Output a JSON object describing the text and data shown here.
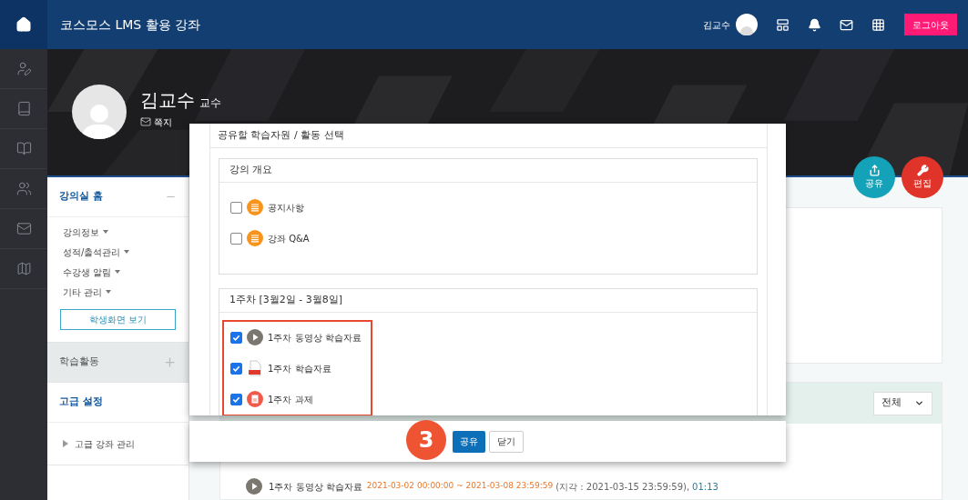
{
  "topbar": {
    "title": "코스모스 LMS 활용 강좌",
    "user_name": "김교수",
    "logout": "로그아웃"
  },
  "profile": {
    "name": "김교수",
    "role": "교수",
    "message_link": "쪽지"
  },
  "sidebar": {
    "sections": [
      {
        "title": "강의실 홈",
        "kind": "link",
        "expanded": true,
        "items": [
          {
            "label": "강의정보",
            "kind": "dropdown"
          },
          {
            "label": "성적/출석관리",
            "kind": "dropdown"
          },
          {
            "label": "수강생 알림",
            "kind": "dropdown"
          },
          {
            "label": "기타 관리",
            "kind": "dropdown"
          }
        ],
        "button": "학생화면 보기"
      },
      {
        "title": "학습활동",
        "kind": "collapsible",
        "expanded": false
      },
      {
        "title": "고급 설정",
        "kind": "link",
        "items": [
          {
            "label": "고급 강좌 관리",
            "kind": "tree"
          }
        ]
      }
    ]
  },
  "action_buttons": [
    {
      "label": "공유",
      "kind": "share"
    },
    {
      "label": "편집",
      "kind": "edit"
    }
  ],
  "filter_select": {
    "value": "전체"
  },
  "activity_line": {
    "title": "1주차 동영상 학습자료",
    "period": "2021-03-02 00:00:00 ~ 2021-03-08 23:59:59",
    "late": "(지각 : 2021-03-15 23:59:59),",
    "duration": "01:13"
  },
  "modal": {
    "title": "공유할 학습자원 / 활동 선택",
    "sections": [
      {
        "title": "강의 개요",
        "highlighted": false,
        "items": [
          {
            "label": "공지사항",
            "kind": "notice",
            "checked": false
          },
          {
            "label": "강좌 Q&A",
            "kind": "notice",
            "checked": false
          }
        ]
      },
      {
        "title": "1주차 [3월2일 - 3월8일]",
        "highlighted": true,
        "items": [
          {
            "label": "1주차 동영상 학습자료",
            "kind": "video",
            "checked": true
          },
          {
            "label": "1주차 학습자료",
            "kind": "pdf",
            "checked": true
          },
          {
            "label": "1주차 과제",
            "kind": "assignment",
            "checked": true
          }
        ]
      }
    ],
    "buttons": [
      {
        "label": "공유",
        "primary": true
      },
      {
        "label": "닫기",
        "primary": false
      }
    ],
    "step_badge": "3"
  }
}
